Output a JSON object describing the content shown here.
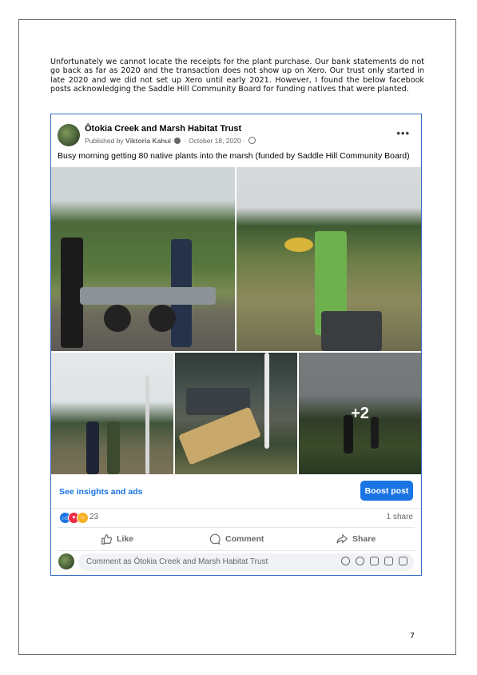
{
  "paragraph": "Unfortunately we cannot locate the receipts for the plant purchase. Our bank statements do not go back as far as 2020 and the transaction does not show up on Xero. Our trust only started in late 2020 and we did not set up Xero until early 2021. However, I found the below facebook posts acknowledging the Saddle Hill Community Board for funding natives that were planted.",
  "post": {
    "page_name": "Ōtokia Creek and Marsh Habitat Trust",
    "published_by_label": "Published by",
    "author": "Viktoria Kahui",
    "date": "October 18, 2020",
    "caption": "Busy morning getting 80 native plants into the marsh (funded by Saddle Hill Community Board)",
    "more_photos": "+2",
    "insights_link": "See insights and ads",
    "boost_button": "Boost post",
    "reaction_count": "23",
    "share_count": "1 share",
    "actions": {
      "like": "Like",
      "comment": "Comment",
      "share": "Share"
    },
    "comment_placeholder": "Comment as Ōtokia Creek and Marsh Habitat Trust"
  },
  "colors": {
    "facebook_blue": "#1b74e4",
    "card_border": "#3b6fc4"
  },
  "page_number": "7"
}
